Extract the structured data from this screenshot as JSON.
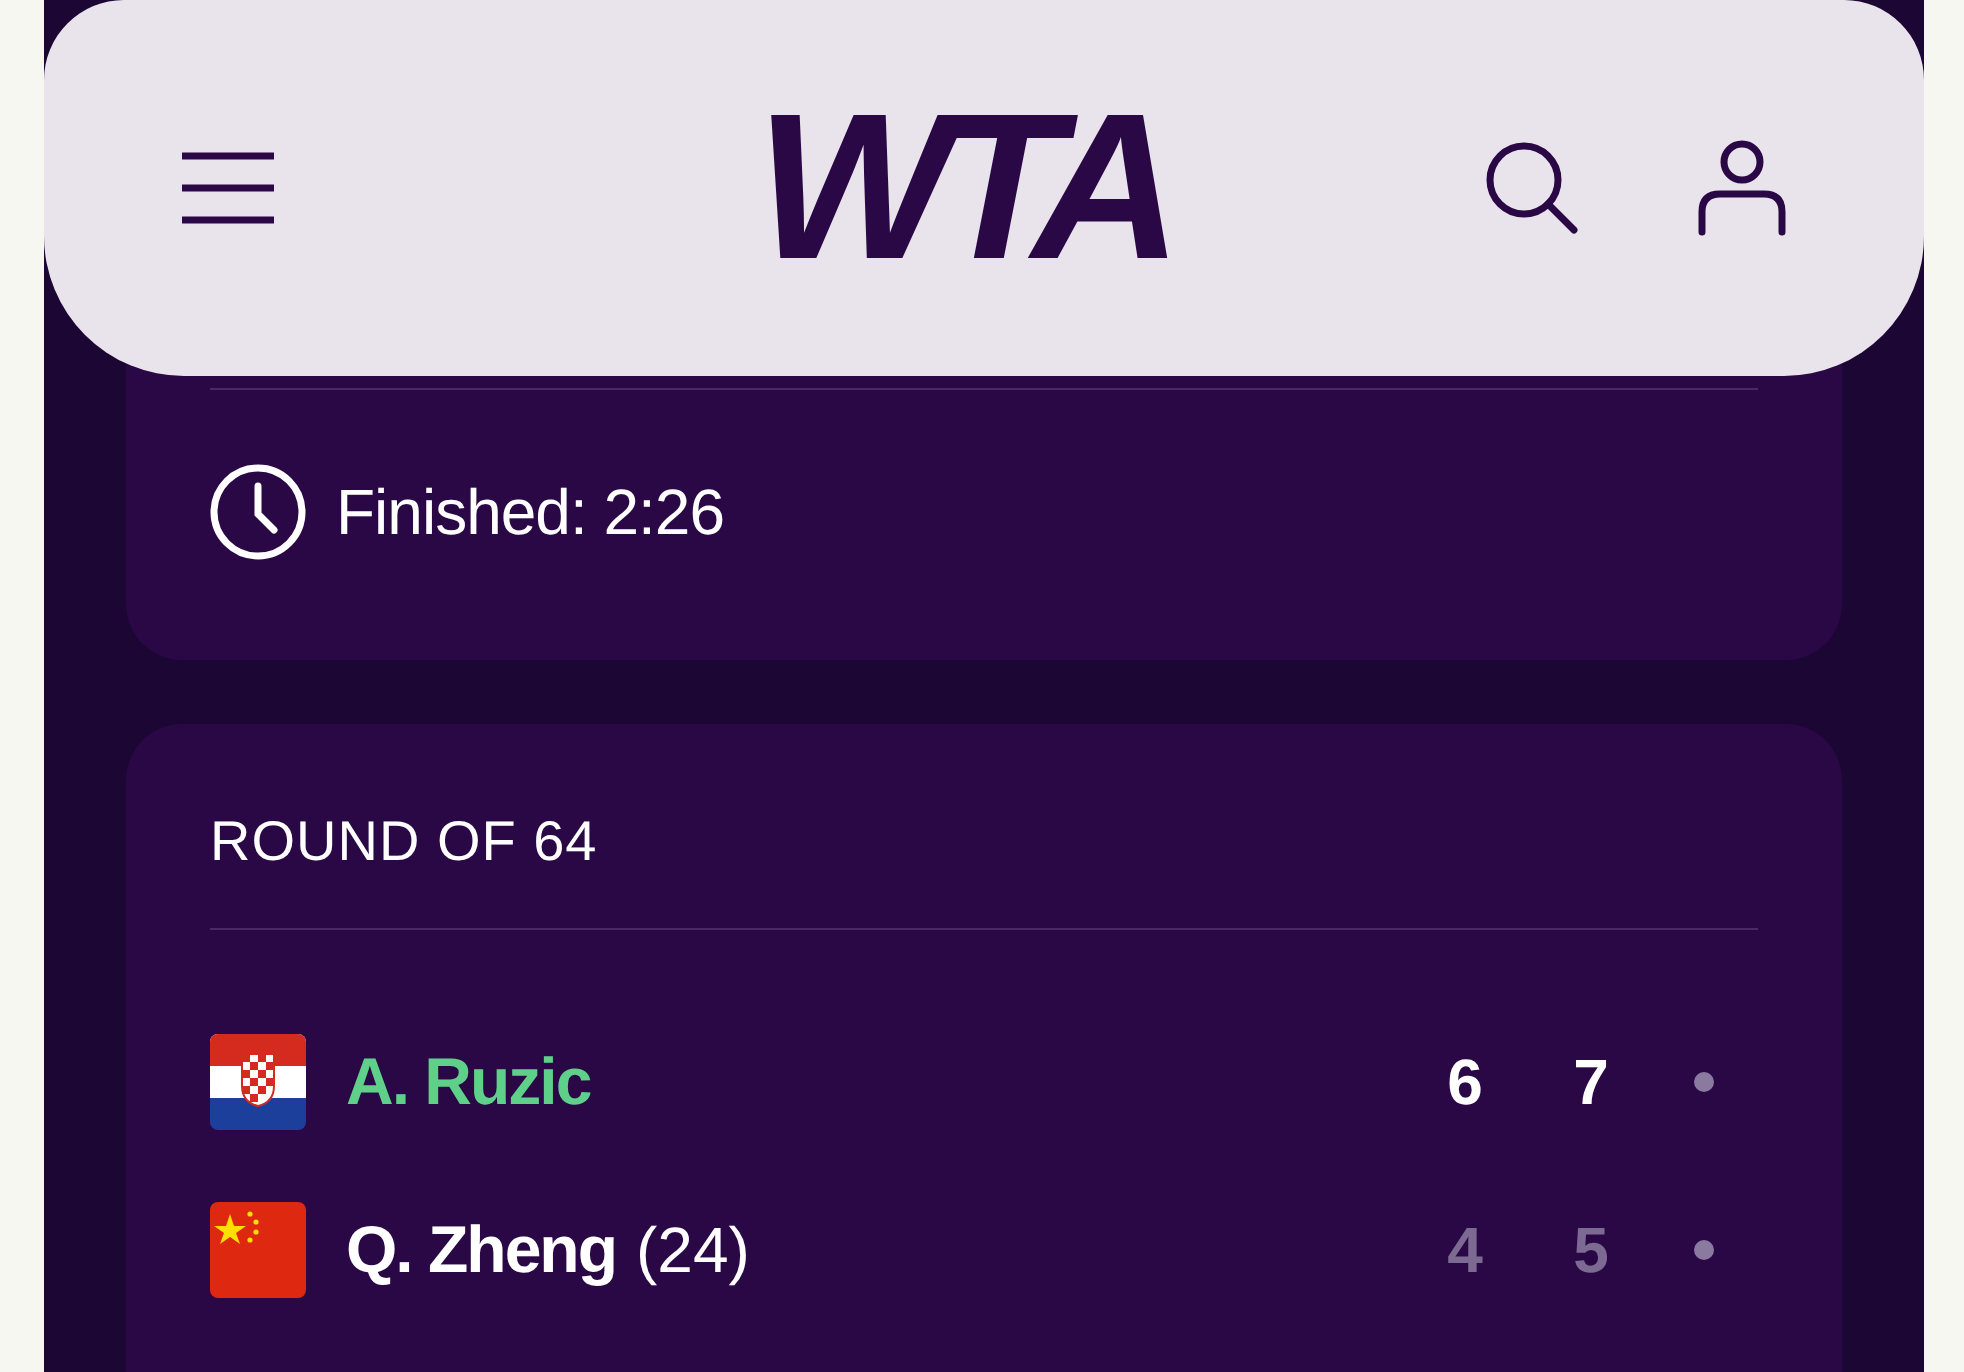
{
  "header": {
    "logo": "WTA"
  },
  "status_card": {
    "status": "Finished: 2:26"
  },
  "match": {
    "round": "ROUND OF 64",
    "players": [
      {
        "kind": "croatia",
        "name": "A. Ruzic",
        "winner": true,
        "scores": [
          "6",
          "7"
        ]
      },
      {
        "kind": "china",
        "name": "Q. Zheng",
        "seed": "(24)",
        "winner": false,
        "scores": [
          "4",
          "5"
        ]
      }
    ]
  }
}
